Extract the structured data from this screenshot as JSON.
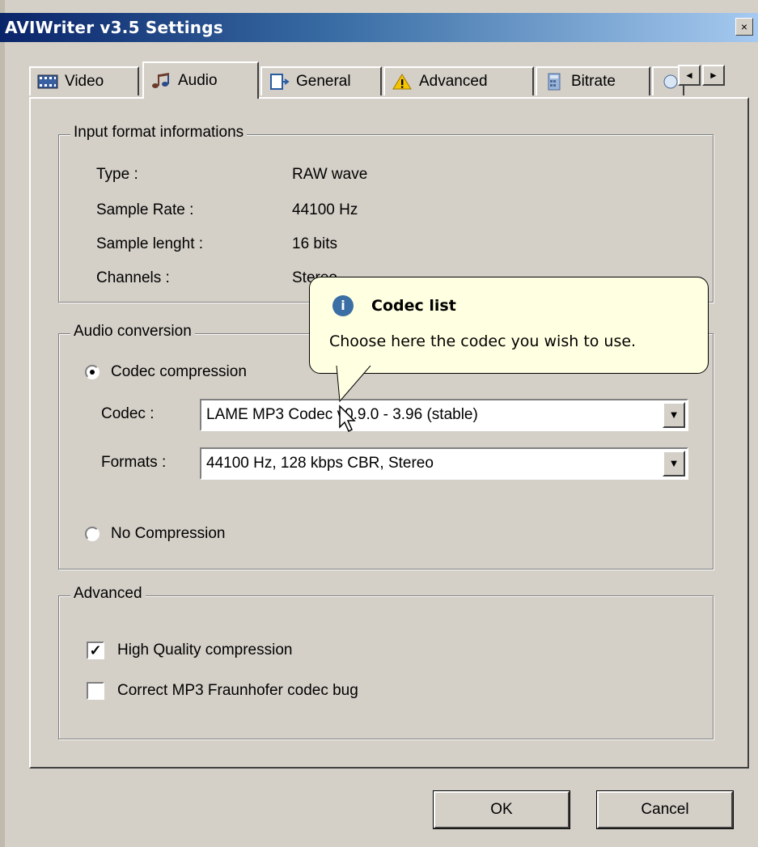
{
  "window": {
    "title": "AVIWriter v3.5 Settings",
    "close_glyph": "×"
  },
  "tabs": [
    {
      "label": "Video",
      "icon": "film-icon"
    },
    {
      "label": "Audio",
      "icon": "music-notes-icon",
      "active": true
    },
    {
      "label": "General",
      "icon": "document-icon"
    },
    {
      "label": "Advanced",
      "icon": "warning-icon"
    },
    {
      "label": "Bitrate",
      "icon": "calculator-icon"
    }
  ],
  "tab_scroll": {
    "left": "◄",
    "right": "►"
  },
  "input_format": {
    "title": "Input format informations",
    "rows": [
      {
        "label": "Type :",
        "value": "RAW wave"
      },
      {
        "label": "Sample Rate :",
        "value": "44100 Hz"
      },
      {
        "label": "Sample lenght :",
        "value": "16 bits"
      },
      {
        "label": "Channels :",
        "value": "Stereo"
      }
    ]
  },
  "audio_conversion": {
    "title": "Audio conversion",
    "codec_compression_label": "Codec compression",
    "codec_compression_selected": true,
    "codec_label": "Codec :",
    "codec_value": "LAME MP3 Codec v0.9.0 - 3.96 (stable)",
    "formats_label": "Formats :",
    "formats_value": "44100 Hz, 128 kbps CBR, Stereo",
    "no_compression_label": "No Compression",
    "no_compression_selected": false
  },
  "advanced": {
    "title": "Advanced",
    "high_quality_label": "High Quality compression",
    "high_quality_checked": true,
    "fraunhofer_label": "Correct MP3 Fraunhofer codec bug",
    "fraunhofer_checked": false
  },
  "tooltip": {
    "icon": "info-icon",
    "icon_glyph": "i",
    "title": "Codec list",
    "text": "Choose here the codec you wish to use."
  },
  "buttons": {
    "ok": "OK",
    "cancel": "Cancel"
  },
  "colors": {
    "tooltip_bg": "#ffffe1",
    "titlebar_start": "#0a246a",
    "titlebar_end": "#a6caf0"
  }
}
